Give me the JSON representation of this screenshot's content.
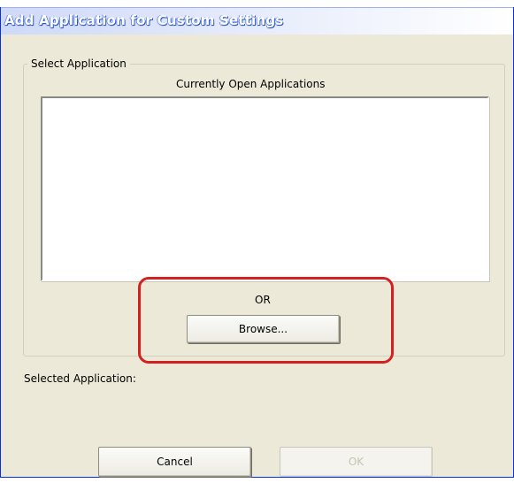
{
  "window": {
    "title": "Add Application for Custom Settings"
  },
  "select_group": {
    "legend": "Select Application",
    "list_caption": "Currently Open Applications",
    "items": []
  },
  "or_text": "OR",
  "buttons": {
    "browse_label": "Browse...",
    "cancel_label": "Cancel",
    "ok_label": "OK",
    "ok_enabled": false
  },
  "selected_application": {
    "label": "Selected Application:",
    "value": ""
  },
  "colors": {
    "dialog_background": "#ece9d8",
    "highlight_annotation": "#d42020",
    "title_text": "#ffffff"
  }
}
